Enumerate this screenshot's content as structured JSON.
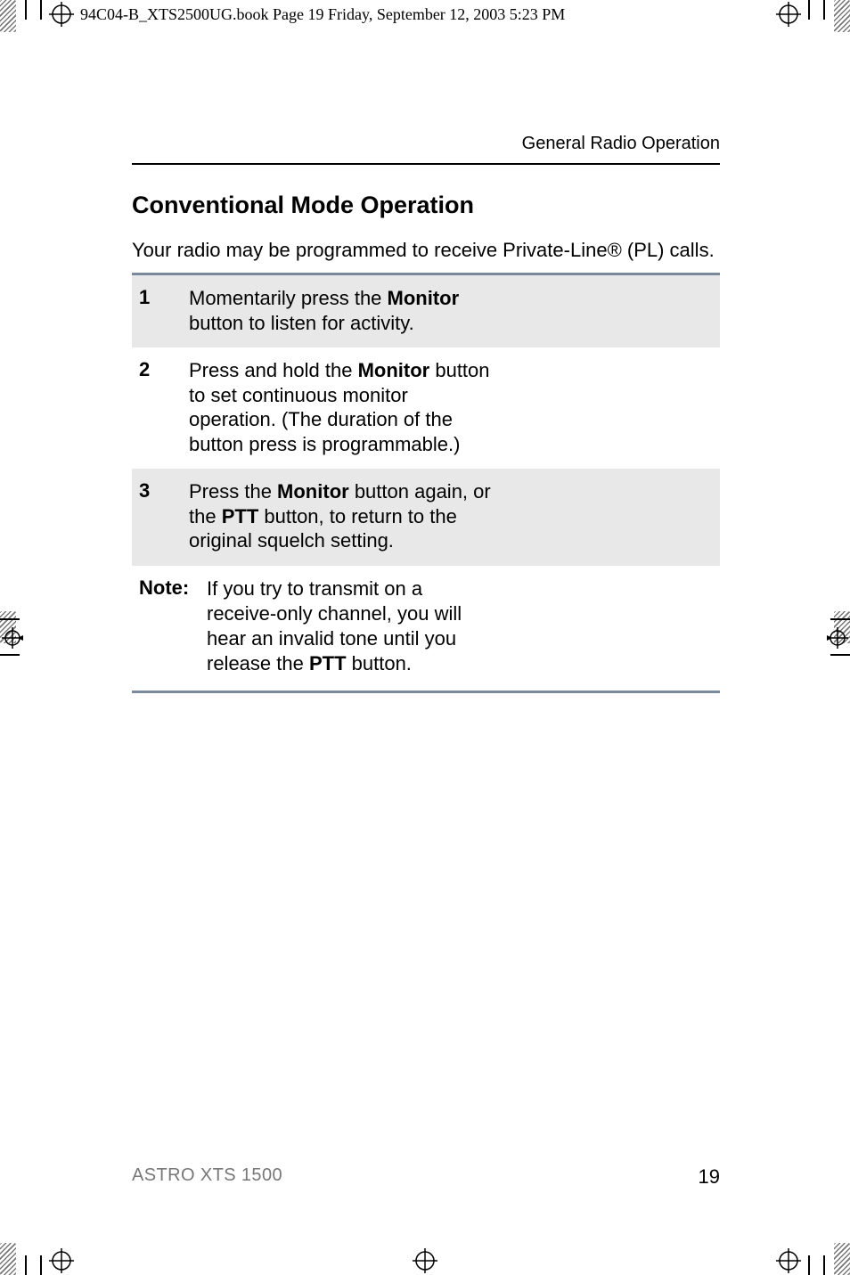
{
  "print_header": "94C04-B_XTS2500UG.book  Page 19  Friday, September 12, 2003  5:23 PM",
  "running_head": "General Radio Operation",
  "heading": "Conventional Mode Operation",
  "intro": "Your radio may be programmed to receive Private-Line® (PL) calls.",
  "steps": [
    {
      "num": "1",
      "pre": "Momentarily press the ",
      "bold1": "Monitor",
      "post": " button to listen for activity."
    },
    {
      "num": "2",
      "pre": "Press and hold the ",
      "bold1": "Monitor",
      "post": " button to set continuous monitor operation. (The duration of the button press is programmable.)"
    },
    {
      "num": "3",
      "pre": "Press the ",
      "bold1": "Monitor",
      "mid": " button again, or the ",
      "bold2": "PTT",
      "post": " button, to return to the original squelch setting."
    }
  ],
  "note": {
    "label": "Note:",
    "pre": "If you try to transmit on a receive-only channel, you will hear an invalid tone until you release the ",
    "bold": "PTT",
    "post": " button."
  },
  "footer_left": "ASTRO XTS 1500",
  "footer_right": "19"
}
